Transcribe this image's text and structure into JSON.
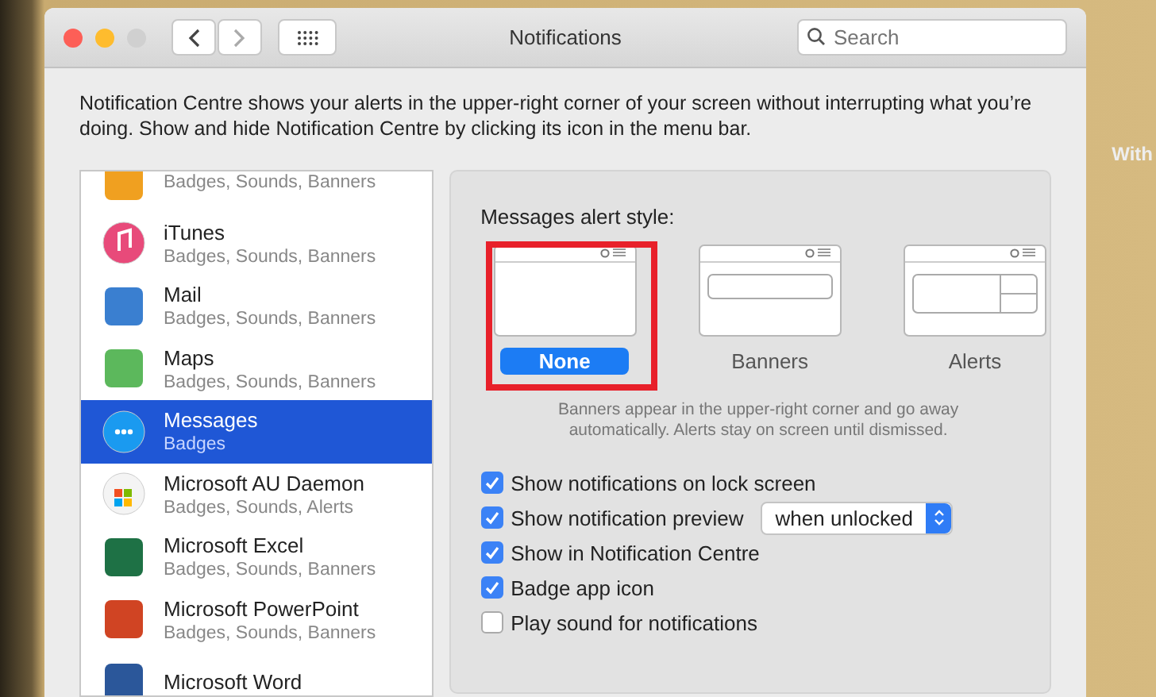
{
  "desktop": {
    "label": "With"
  },
  "window": {
    "title": "Notifications",
    "search": {
      "placeholder": "Search"
    }
  },
  "description": "Notification Centre shows your alerts in the upper-right corner of your screen without interrupting what you’re doing. Show and hide Notification Centre by clicking its icon in the menu bar.",
  "apps": [
    {
      "summary": "Badges, Sounds, Banners",
      "selected": false
    },
    {
      "name": "iTunes",
      "summary": "Badges, Sounds, Banners",
      "selected": false
    },
    {
      "name": "Mail",
      "summary": "Badges, Sounds, Banners",
      "selected": false
    },
    {
      "name": "Maps",
      "summary": "Badges, Sounds, Banners",
      "selected": false
    },
    {
      "name": "Messages",
      "summary": "Badges",
      "selected": true
    },
    {
      "name": "Microsoft AU Daemon",
      "summary": "Badges, Sounds, Alerts",
      "selected": false
    },
    {
      "name": "Microsoft Excel",
      "summary": "Badges, Sounds, Banners",
      "selected": false
    },
    {
      "name": "Microsoft PowerPoint",
      "summary": "Badges, Sounds, Banners",
      "selected": false
    },
    {
      "name": "Microsoft Word",
      "selected": false
    }
  ],
  "alert_style": {
    "label": "Messages alert style:",
    "options": [
      {
        "label": "None",
        "kind": "none",
        "selected": true
      },
      {
        "label": "Banners",
        "kind": "banner",
        "selected": false
      },
      {
        "label": "Alerts",
        "kind": "alert",
        "selected": false
      }
    ],
    "caption": "Banners appear in the upper-right corner and go away automatically. Alerts stay on screen until dismissed."
  },
  "settings": [
    {
      "label": "Show notifications on lock screen",
      "checked": true
    },
    {
      "label": "Show notification preview",
      "checked": true,
      "dropdown": "when unlocked"
    },
    {
      "label": "Show in Notification Centre",
      "checked": true
    },
    {
      "label": "Badge app icon",
      "checked": true
    },
    {
      "label": "Play sound for notifications",
      "checked": false
    }
  ]
}
